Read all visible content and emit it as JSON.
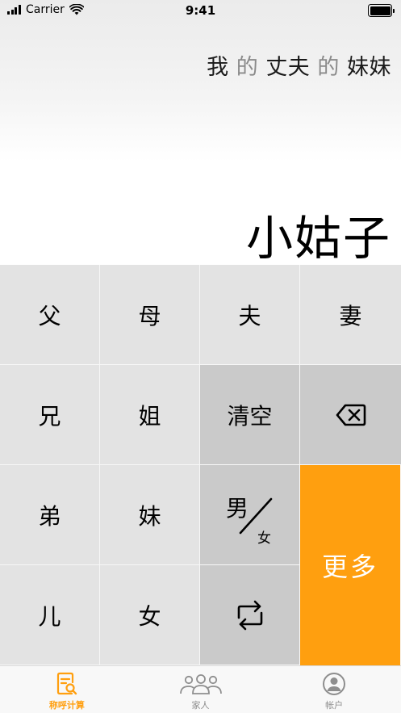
{
  "status_bar": {
    "carrier": "Carrier",
    "time": "9:41"
  },
  "display": {
    "expression": [
      "我",
      "的",
      "丈夫",
      "的",
      "妹妹"
    ],
    "result": "小姑子"
  },
  "keypad": {
    "father": "父",
    "mother": "母",
    "husband": "夫",
    "wife": "妻",
    "elder_brother": "兄",
    "elder_sister": "姐",
    "clear": "清空",
    "younger_brother": "弟",
    "younger_sister": "妹",
    "male": "男",
    "female": "女",
    "more": "更多",
    "son": "儿",
    "daughter": "女"
  },
  "tabbar": {
    "tabs": [
      {
        "label": "称呼计算",
        "icon": "document-search-icon",
        "active": true
      },
      {
        "label": "家人",
        "icon": "people-group-icon",
        "active": false
      },
      {
        "label": "帐户",
        "icon": "account-icon",
        "active": false
      }
    ]
  },
  "colors": {
    "accent": "#ff9f0f",
    "key_light": "#e3e3e3",
    "key_dark": "#cacaca",
    "tab_inactive": "#8e8e8e"
  }
}
